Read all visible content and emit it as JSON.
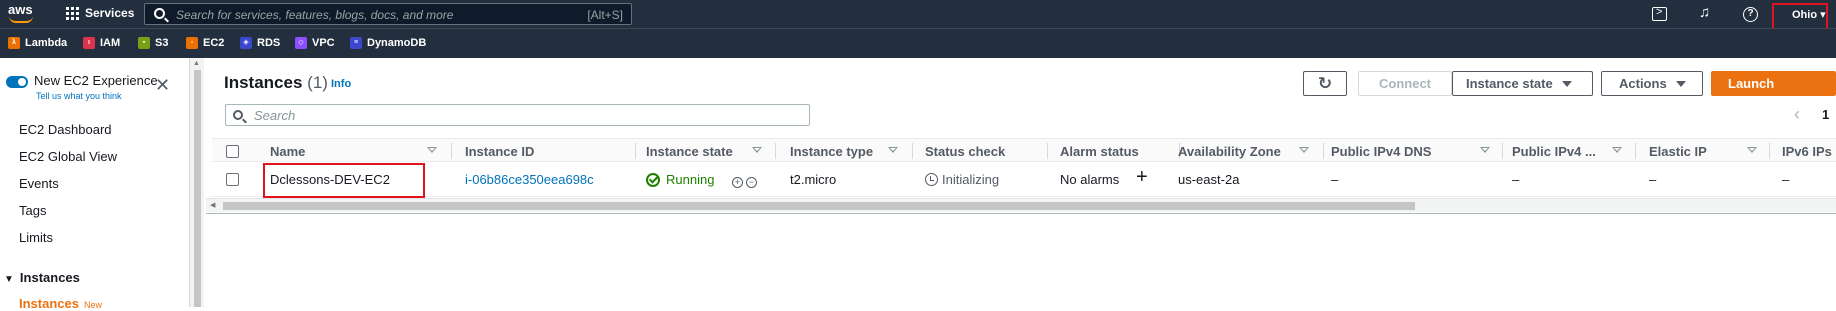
{
  "topnav": {
    "logo": "aws",
    "services_label": "Services",
    "search_placeholder": "Search for services, features, blogs, docs, and more",
    "search_shortcut": "[Alt+S]",
    "region": "Ohio ▾"
  },
  "favorites": [
    {
      "label": "Lambda",
      "icon": "lambda-icon",
      "color": "#ed7100"
    },
    {
      "label": "IAM",
      "icon": "iam-icon",
      "color": "#dd344c"
    },
    {
      "label": "S3",
      "icon": "s3-icon",
      "color": "#7aa116"
    },
    {
      "label": "EC2",
      "icon": "ec2-icon",
      "color": "#ed7100"
    },
    {
      "label": "RDS",
      "icon": "rds-icon",
      "color": "#3b48cc"
    },
    {
      "label": "VPC",
      "icon": "vpc-icon",
      "color": "#8c4fff"
    },
    {
      "label": "DynamoDB",
      "icon": "dynamodb-icon",
      "color": "#3b48cc"
    }
  ],
  "sidebar": {
    "experience_label": "New EC2 Experience",
    "feedback_link": "Tell us what you think",
    "items": [
      "EC2 Dashboard",
      "EC2 Global View",
      "Events",
      "Tags",
      "Limits"
    ],
    "section": "Instances",
    "active_item": "Instances",
    "active_badge": "New"
  },
  "main": {
    "title": "Instances",
    "count": "(1)",
    "info": "Info",
    "buttons": {
      "connect": "Connect",
      "instance_state": "Instance state",
      "actions": "Actions",
      "launch": "Launch instances"
    },
    "filter_placeholder": "Search",
    "page": "1"
  },
  "table": {
    "columns": [
      "Name",
      "Instance ID",
      "Instance state",
      "Instance type",
      "Status check",
      "Alarm status",
      "Availability Zone",
      "Public IPv4 DNS",
      "Public IPv4 ...",
      "Elastic IP",
      "IPv6 IPs"
    ],
    "rows": [
      {
        "name": "Dclessons-DEV-EC2",
        "instance_id": "i-06b86ce350eea698c",
        "state": "Running",
        "type": "t2.micro",
        "status_check": "Initializing",
        "alarm_status": "No alarms",
        "az": "us-east-2a",
        "public_dns": "–",
        "public_ipv4": "–",
        "elastic_ip": "–",
        "ipv6": "–"
      }
    ]
  },
  "colors": {
    "nav_bg": "#232f3e",
    "accent_orange": "#ec7211",
    "link_blue": "#0073bb",
    "success_green": "#1d8102",
    "highlight_red": "#e0141e"
  }
}
